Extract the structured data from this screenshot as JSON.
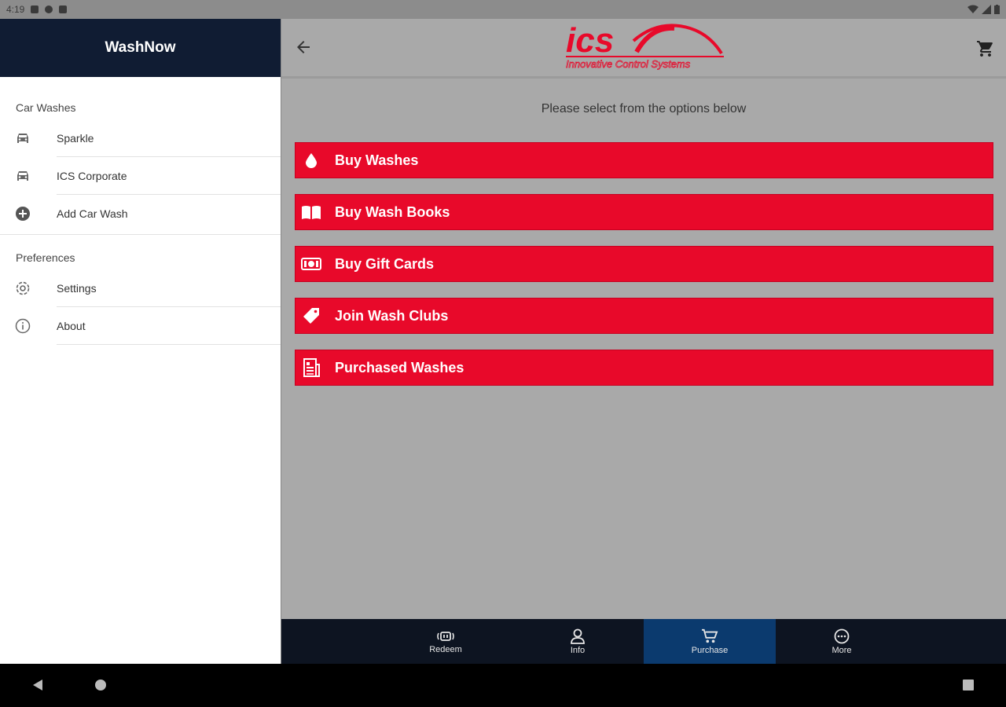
{
  "status_bar": {
    "time": "4:19"
  },
  "drawer": {
    "title": "WashNow",
    "sections": [
      {
        "title": "Car Washes",
        "items": [
          {
            "label": "Sparkle",
            "icon": "car-icon"
          },
          {
            "label": "ICS Corporate",
            "icon": "car-icon"
          },
          {
            "label": "Add Car Wash",
            "icon": "add-circle-icon"
          }
        ]
      },
      {
        "title": "Preferences",
        "items": [
          {
            "label": "Settings",
            "icon": "gear-icon"
          },
          {
            "label": "About",
            "icon": "info-icon"
          }
        ]
      }
    ]
  },
  "header": {
    "logo_text": "ics",
    "logo_subtitle": "Innovative Control Systems"
  },
  "main": {
    "instruction": "Please select from the options below",
    "options": [
      {
        "label": "Buy Washes",
        "icon": "drop-icon"
      },
      {
        "label": "Buy Wash Books",
        "icon": "book-icon"
      },
      {
        "label": "Buy Gift Cards",
        "icon": "gift-card-icon"
      },
      {
        "label": "Join Wash Clubs",
        "icon": "tag-icon"
      },
      {
        "label": "Purchased Washes",
        "icon": "receipt-icon"
      }
    ]
  },
  "bottom_nav": {
    "items": [
      {
        "label": "Redeem",
        "icon": "redeem-icon",
        "active": false
      },
      {
        "label": "Info",
        "icon": "person-icon",
        "active": false
      },
      {
        "label": "Purchase",
        "icon": "cart-icon",
        "active": true
      },
      {
        "label": "More",
        "icon": "more-icon",
        "active": false
      }
    ]
  },
  "colors": {
    "accent_red": "#e8092a",
    "drawer_header": "#101c33",
    "nav_bg": "#0d1421",
    "nav_active": "#0b3a6e",
    "content_bg": "#a9a9a9"
  }
}
